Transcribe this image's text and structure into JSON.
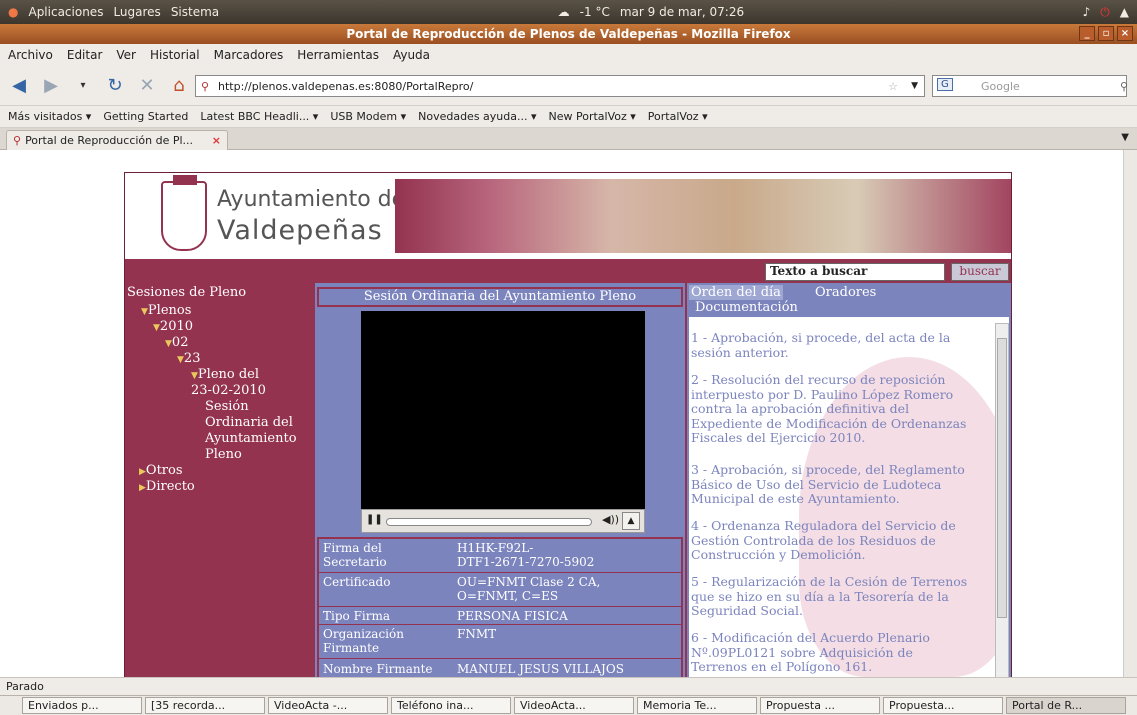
{
  "system_panel": {
    "menus": [
      "Aplicaciones",
      "Lugares",
      "Sistema"
    ],
    "weather": "-1 °C",
    "clock": "mar 9 de mar, 07:26"
  },
  "window": {
    "title": "Portal de Reproducción de Plenos de Valdepeñas - Mozilla Firefox"
  },
  "menubar": [
    "Archivo",
    "Editar",
    "Ver",
    "Historial",
    "Marcadores",
    "Herramientas",
    "Ayuda"
  ],
  "navbar": {
    "url": "http://plenos.valdepenas.es:8080/PortalRepro/",
    "search_placeholder": "Google",
    "search_engine": "G"
  },
  "bookmarks": [
    "Más visitados ▾",
    "Getting Started",
    "Latest BBC Headli... ▾",
    "USB Modem ▾",
    "Novedades ayuda... ▾",
    "New PortalVoz ▾",
    "PortalVoz ▾"
  ],
  "tab": {
    "label": "Portal de Reproducción de Pl..."
  },
  "site": {
    "logo_line1": "Ayuntamiento de",
    "logo_line2": "Valdepeñas",
    "search_text": "Texto a buscar",
    "search_button": "buscar",
    "tree": {
      "heading": "Sesiones de Pleno",
      "plenos": "Plenos",
      "year": "2010",
      "month": "02",
      "day": "23",
      "pleno_a": "Pleno del",
      "pleno_b": "23-02-2010",
      "session_lines": [
        "Sesión",
        "Ordinaria del",
        "Ayuntamiento",
        "Pleno"
      ],
      "otros": "Otros",
      "directo": "Directo"
    },
    "session_title": "Sesión Ordinaria del Ayuntamiento Pleno",
    "signature": [
      {
        "k": [
          "Firma del",
          "Secretario"
        ],
        "v": [
          "H1HK-F92L-",
          "DTF1-2671-7270-5902"
        ]
      },
      {
        "k": [
          "Certificado"
        ],
        "v": [
          "OU=FNMT Clase 2 CA,",
          "O=FNMT, C=ES"
        ]
      },
      {
        "k": [
          "Tipo Firma"
        ],
        "v": [
          "PERSONA FISICA"
        ]
      },
      {
        "k": [
          "Organización",
          "Firmante"
        ],
        "v": [
          "FNMT"
        ]
      },
      {
        "k": [
          "Nombre Firmante"
        ],
        "v": [
          "MANUEL JESUS VILLAJOS"
        ]
      }
    ],
    "right_tabs": {
      "orden": "Orden del día",
      "oradores": "Oradores",
      "documentacion": "Documentación"
    },
    "agenda": [
      [
        "1 - Aprobación, si procede, del acta de la",
        "sesión anterior."
      ],
      [
        "2 - Resolución del recurso de reposición",
        "interpuesto por D. Paulino López Romero",
        "contra la aprobación definitiva del",
        "Expediente de Modificación de Ordenanzas",
        "Fiscales del Ejercicio 2010."
      ],
      [
        "3 - Aprobación, si procede, del Reglamento",
        "Básico de Uso del Servicio de Ludoteca",
        "Municipal de este Ayuntamiento."
      ],
      [
        "4 - Ordenanza Reguladora del Servicio de",
        "Gestión Controlada de los Residuos de",
        "Construcción y Demolición."
      ],
      [
        "5 - Regularización de la Cesión de Terrenos",
        "que se hizo en su día a la Tesorería de la",
        "Seguridad Social."
      ],
      [
        "6 - Modificación del Acuerdo Plenario",
        "Nº.09PL0121 sobre Adquisición de",
        "Terrenos en el Polígono 161."
      ]
    ]
  },
  "status_text": "Parado",
  "taskbar": [
    "Enviados p...",
    "[35 recorda...",
    "VideoActa -...",
    "Teléfono ina...",
    "VideoActa...",
    "Memoria Te...",
    "Propuesta ...",
    "Propuesta...",
    "Portal de R..."
  ]
}
